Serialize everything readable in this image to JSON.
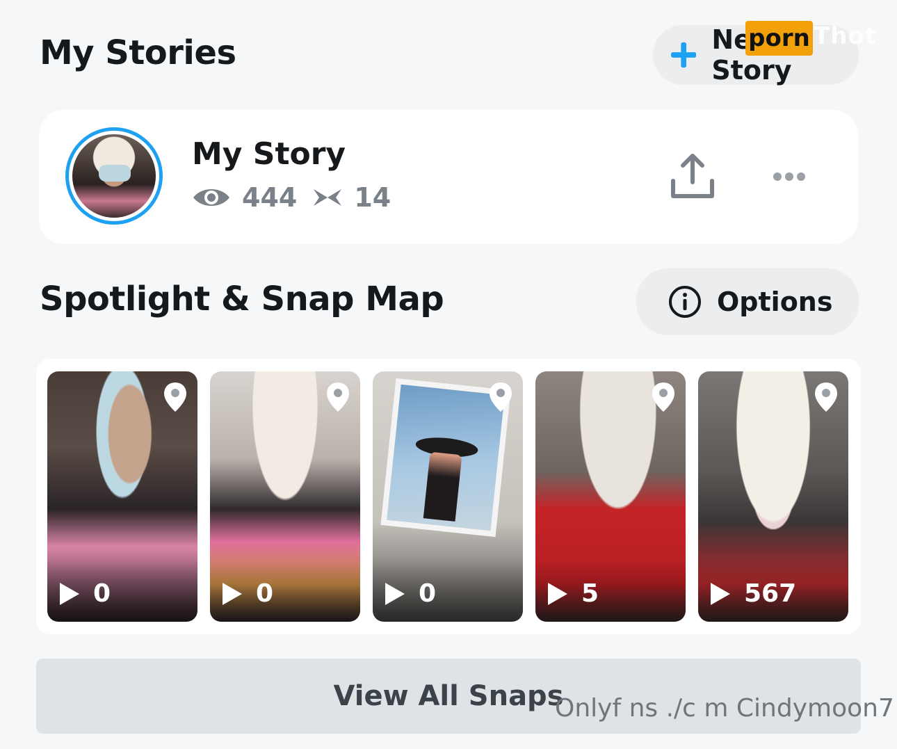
{
  "my_stories": {
    "title": "My Stories",
    "new_story_label": "New Story",
    "story": {
      "name": "My Story",
      "views": "444",
      "screenshots": "14"
    }
  },
  "spotlight": {
    "title": "Spotlight & Snap Map",
    "options_label": "Options",
    "thumbnails": [
      {
        "count": "0"
      },
      {
        "count": "0"
      },
      {
        "count": "0"
      },
      {
        "count": "5"
      },
      {
        "count": "567"
      }
    ],
    "view_all_label": "View All Snaps"
  },
  "watermarks": {
    "badge": "porn",
    "badge_suffix": "Thot",
    "bottom": "Onlyf ns ./c m Cindymoon7"
  },
  "colors": {
    "accent_blue": "#1ea1f2",
    "background": "#f6f7f8",
    "pill_bg": "#ebedef"
  },
  "icons": [
    "plus-icon",
    "eye-icon",
    "screenshot-icon",
    "upload-icon",
    "more-icon",
    "info-icon",
    "location-pin-icon",
    "play-icon"
  ]
}
